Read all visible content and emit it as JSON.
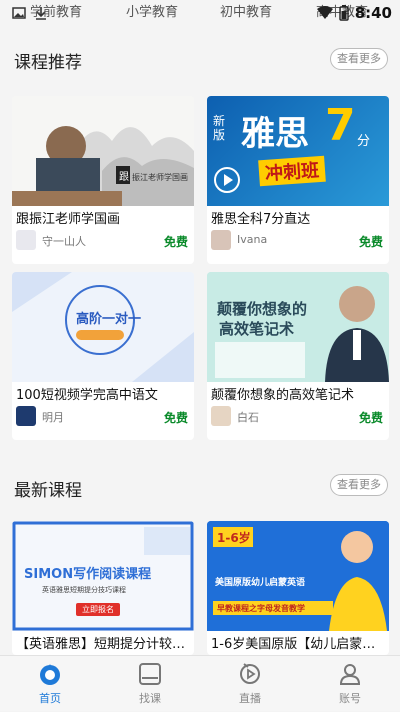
{
  "status_bar": {
    "time": "8:40"
  },
  "category_tabs": [
    "学前教育",
    "小学教育",
    "初中教育",
    "高中教育"
  ],
  "recommended": {
    "title": "课程推荐",
    "more_label": "查看更多",
    "courses": [
      {
        "title": "跟振江老师学国画",
        "author": "守一山人",
        "price": "免费",
        "thumb_text": "振江老师学国画",
        "thumb_badge": "跟"
      },
      {
        "title": "雅思全科7分直达",
        "author": "Ivana",
        "price": "免费",
        "thumb_text_1": "新版",
        "thumb_text_2": "雅思",
        "thumb_text_3": "7",
        "thumb_text_4": "分",
        "thumb_text_5": "冲刺班"
      },
      {
        "title": "100短视频学完高中语文",
        "author": "明月",
        "price": "免费",
        "thumb_text": "高阶一对一"
      },
      {
        "title": "颠覆你想象的高效笔记术",
        "author": "白石",
        "price": "免费",
        "thumb_text_1": "颠覆你想象的",
        "thumb_text_2": "高效笔记术"
      }
    ]
  },
  "latest": {
    "title": "最新课程",
    "more_label": "查看更多",
    "courses": [
      {
        "title": "【英语雅思】短期提分计较…",
        "thumb_text": "SIMON写作阅读课程",
        "thumb_sub": "英语雅思短期提分技巧课程",
        "thumb_btn": "立即报名"
      },
      {
        "title": "1-6岁美国原版【幼儿启蒙】…",
        "thumb_text_1": "1-6岁",
        "thumb_text_2": "美国原版幼儿启蒙英语",
        "thumb_text_3": "早教课程之字母发音教学"
      }
    ]
  },
  "tab_bar": {
    "items": [
      {
        "label": "首页",
        "icon": "home-icon",
        "active": true
      },
      {
        "label": "找课",
        "icon": "book-icon",
        "active": false
      },
      {
        "label": "直播",
        "icon": "live-icon",
        "active": false
      },
      {
        "label": "账号",
        "icon": "account-icon",
        "active": false
      }
    ]
  },
  "colors": {
    "accent": "#1f7ad8",
    "price": "#0a8a2a"
  }
}
